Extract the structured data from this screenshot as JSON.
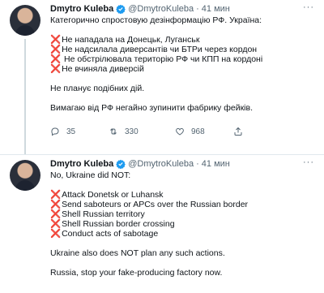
{
  "tweets": [
    {
      "author": {
        "name": "Dmytro Kuleba",
        "handle": "@DmytroKuleba",
        "time": "41 мин"
      },
      "intro": "Категорично спростовую дезінформацію РФ. Україна:",
      "items": [
        "Не нападала на Донецьк, Луганськ",
        "Не надсилала диверсантів чи БТРи через кордон",
        " Не обстрілювала територію РФ чи КПП на кордоні",
        "Не вчиняла диверсій"
      ],
      "para1": "Не планує подібних дій.",
      "para2": "Вимагаю від РФ негайно зупинити фабрику фейків.",
      "stats": {
        "replies": "35",
        "retweets": "330",
        "likes": "968"
      }
    },
    {
      "author": {
        "name": "Dmytro Kuleba",
        "handle": "@DmytroKuleba",
        "time": "41 мин"
      },
      "intro": "No, Ukraine did NOT:",
      "items": [
        "Attack Donetsk or Luhansk",
        "Send saboteurs or APCs over the Russian border",
        "Shell Russian territory",
        "Shell Russian border crossing",
        "Conduct acts of sabotage"
      ],
      "para1": "Ukraine also does NOT plan any such actions.",
      "para2": "Russia, stop your fake-producing factory now."
    }
  ],
  "colors": {
    "accent": "#1d9bf0",
    "cross": "#dd2e44",
    "muted": "#536471"
  },
  "icons": {
    "verified": "verified-badge-icon",
    "list": "cross-mark-icon",
    "more": "more-icon"
  },
  "symbols": {
    "cross": "❌",
    "more": "···",
    "dot": "·"
  }
}
